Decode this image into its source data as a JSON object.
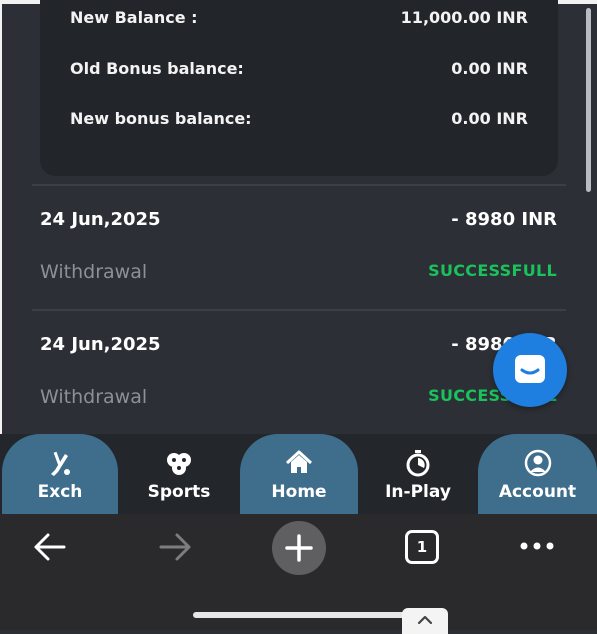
{
  "balance_card": {
    "rows": [
      {
        "label": "New Balance :",
        "value": "11,000.00 INR"
      },
      {
        "label": "Old Bonus balance:",
        "value": "0.00 INR"
      },
      {
        "label": "New bonus balance:",
        "value": "0.00 INR"
      }
    ]
  },
  "transactions": [
    {
      "date": "24 Jun,2025",
      "amount": "- 8980 INR",
      "type": "Withdrawal",
      "status": "SUCCESSFULL"
    },
    {
      "date": "24 Jun,2025",
      "amount": "- 8980 INR",
      "type": "Withdrawal",
      "status": "SUCCESSFULL"
    }
  ],
  "bottom_nav": {
    "items": [
      {
        "label": "Exch",
        "icon": "cricket-bat-icon"
      },
      {
        "label": "Sports",
        "icon": "sports-balls-icon"
      },
      {
        "label": "Home",
        "icon": "home-icon"
      },
      {
        "label": "In-Play",
        "icon": "stopwatch-icon"
      },
      {
        "label": "Account",
        "icon": "account-icon"
      }
    ]
  },
  "browser_toolbar": {
    "tab_count": "1"
  },
  "colors": {
    "background": "#2c2f35",
    "card": "#22252a",
    "success": "#19c25c",
    "nav_highlight": "#3e6e8b",
    "chat_fab": "#1e7fe0"
  }
}
